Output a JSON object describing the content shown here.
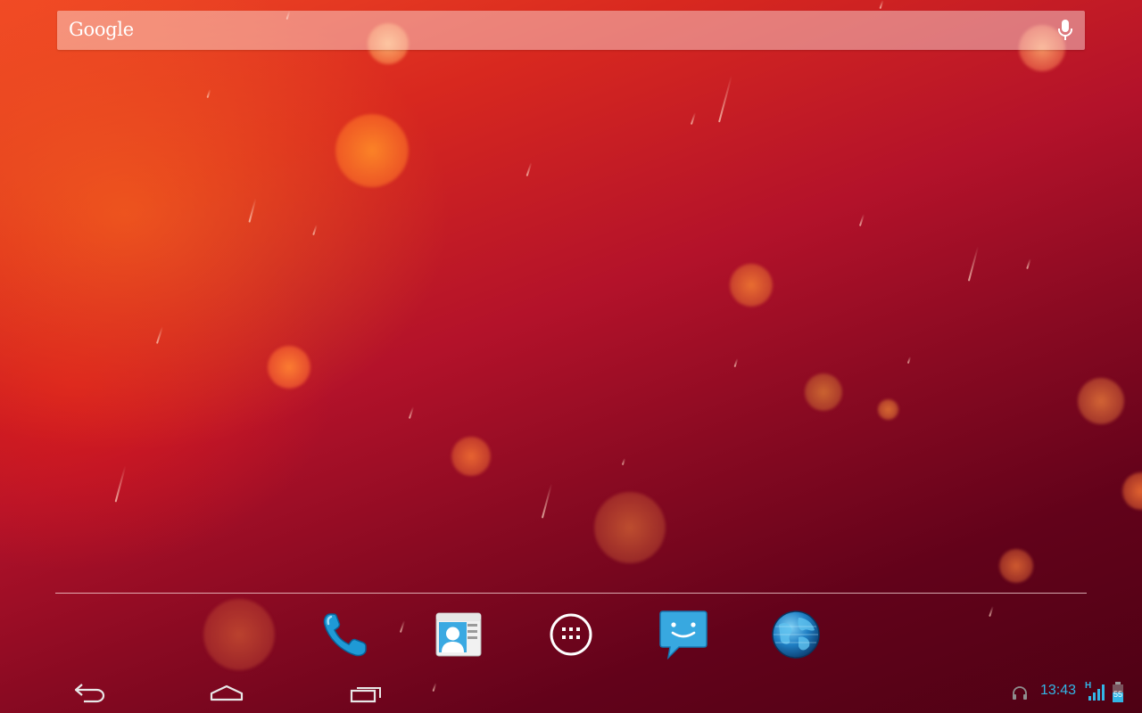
{
  "search_bar": {
    "logo_text": "Google",
    "mic_icon": "mic-icon"
  },
  "dock": {
    "apps": [
      {
        "name": "phone",
        "icon": "phone-icon"
      },
      {
        "name": "contacts",
        "icon": "contacts-icon"
      },
      {
        "name": "all-apps",
        "icon": "app-drawer-icon"
      },
      {
        "name": "messaging",
        "icon": "messaging-icon"
      },
      {
        "name": "browser",
        "icon": "globe-icon"
      }
    ]
  },
  "navigation": {
    "buttons": [
      "back-icon",
      "home-icon",
      "recent-apps-icon"
    ]
  },
  "status_bar": {
    "clock": "13:43",
    "network_type": "H",
    "battery_level": "55",
    "icons": [
      "headset-icon",
      "signal-icon",
      "battery-icon"
    ]
  },
  "colors": {
    "accent": "#33b5e5",
    "wallpaper_top_left": "#f14a25",
    "wallpaper_bottom_right": "#4e0114"
  }
}
